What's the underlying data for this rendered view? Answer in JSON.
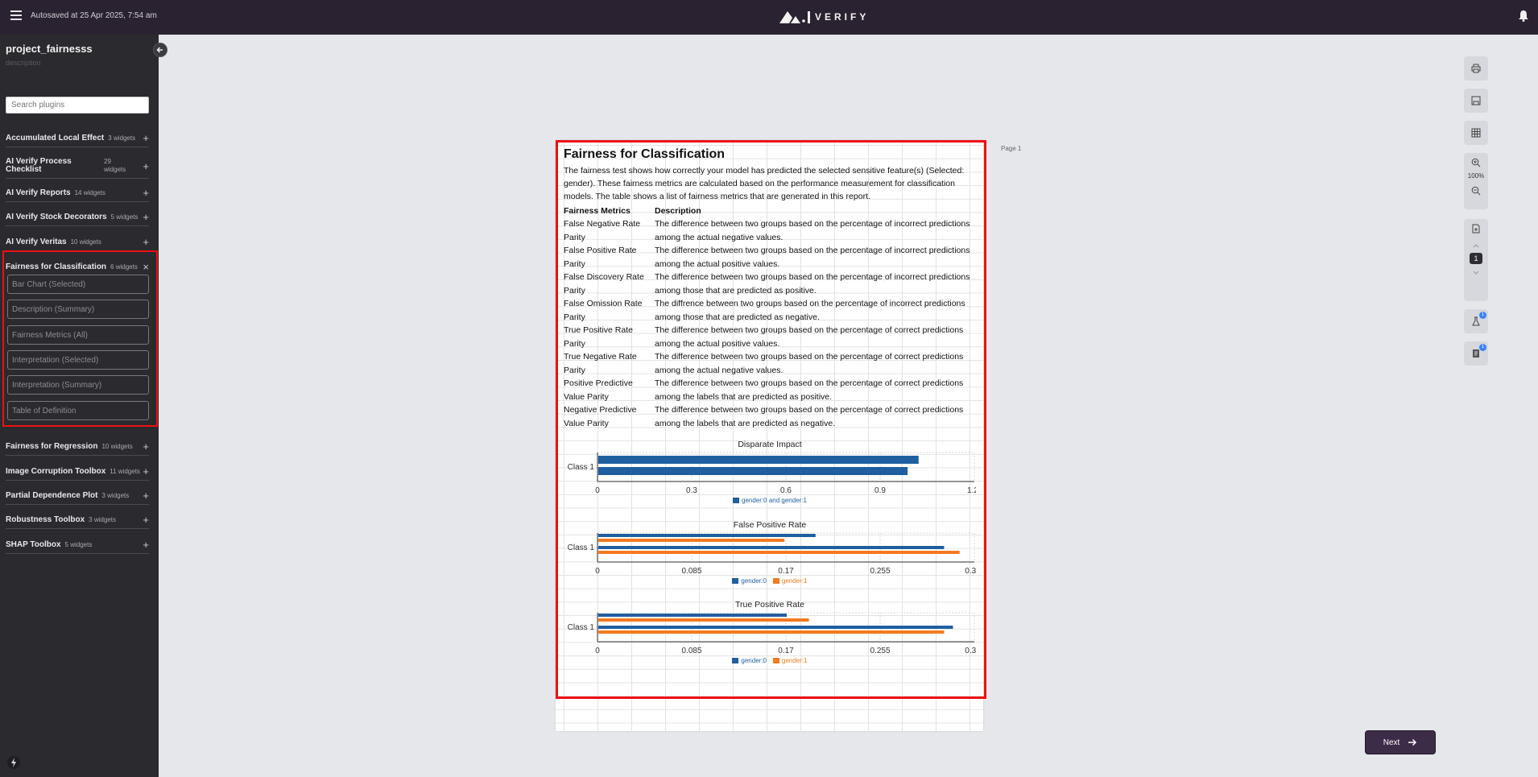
{
  "topbar": {
    "autosave": "Autosaved at 25 Apr 2025, 7:54 am",
    "logo_text": "VERIFY"
  },
  "sidebar": {
    "project_title": "project_fairnesss",
    "project_description": "description",
    "search_placeholder": "Search plugins",
    "plugins": [
      {
        "name": "Accumulated Local Effect",
        "count": "3 widgets",
        "action": "+"
      },
      {
        "name": "AI Verify Process Checklist",
        "count": "29 widgets",
        "action": "+"
      },
      {
        "name": "AI Verify Reports",
        "count": "14 widgets",
        "action": "+"
      },
      {
        "name": "AI Verify Stock Decorators",
        "count": "5 widgets",
        "action": "+"
      },
      {
        "name": "AI Verify Veritas",
        "count": "10 widgets",
        "action": "+"
      },
      {
        "name": "Fairness for Classification",
        "count": "6 widgets",
        "action": "×"
      },
      {
        "name": "Fairness for Regression",
        "count": "10 widgets",
        "action": "+"
      },
      {
        "name": "Image Corruption Toolbox",
        "count": "11 widgets",
        "action": "+"
      },
      {
        "name": "Partial Dependence Plot",
        "count": "3 widgets",
        "action": "+"
      },
      {
        "name": "Robustness Toolbox",
        "count": "3 widgets",
        "action": "+"
      },
      {
        "name": "SHAP Toolbox",
        "count": "5 widgets",
        "action": "+"
      }
    ],
    "widgets": [
      "Bar Chart (Selected)",
      "Description (Summary)",
      "Fairness Metrics (All)",
      "Interpretation (Selected)",
      "Interpretation (Summary)",
      "Table of Definition"
    ]
  },
  "page": {
    "label": "Page 1",
    "title": "Fairness for Classification",
    "intro": "The fairness test shows how correctly your model has predicted the selected sensitive feature(s) (Selected: gender). These fairness metrics are calculated based on the performance measurement for classification models. The table shows a list of fairness metrics that are generated in this report.",
    "table_headers": [
      "Fairness Metrics",
      "Description"
    ],
    "metrics": [
      {
        "name": "False Negative Rate Parity",
        "desc": "The difference between two groups based on the percentage of incorrect predictions among the actual negative values."
      },
      {
        "name": "False Positive Rate Parity",
        "desc": "The difference between two groups based on the percentage of incorrect predictions among the actual positive values."
      },
      {
        "name": "False Discovery Rate Parity",
        "desc": "The difference between two groups based on the percentage of incorrect predictions among those that are predicted as positive."
      },
      {
        "name": "False Omission Rate Parity",
        "desc": "The diffrence between two groups based on the percentage of incorrect predictions among those that are predicted as negative."
      },
      {
        "name": "True Positive Rate Parity",
        "desc": "The difference between two groups based on the percentage of correct predictions among the actual positive values."
      },
      {
        "name": "True Negative Rate Parity",
        "desc": "The difference between two groups based on the percentage of correct predictions among the actual negative values."
      },
      {
        "name": "Positive Predictive Value Parity",
        "desc": "The difference between two groups based on the percentage of correct predictions among the labels that are predicted as positive."
      },
      {
        "name": "Negative Predictive Value Parity",
        "desc": "The difference between two groups based on the percentage of correct predictions among the labels that are predicted as negative."
      }
    ]
  },
  "chart_data": [
    {
      "type": "bar",
      "title": "Disparate Impact",
      "categories": [
        "Class 1"
      ],
      "ticks": [
        "0",
        "0.3",
        "0.6",
        "0.9",
        "1.2"
      ],
      "xlim": [
        0,
        1.2
      ],
      "series": [
        {
          "name": "gender:0 and gender:1",
          "values": [
            1.02,
            0.985
          ],
          "color": "#1f5fa0"
        }
      ],
      "legend": [
        "gender:0 and gender:1"
      ]
    },
    {
      "type": "bar",
      "title": "False Positive Rate",
      "categories": [
        "Class 1"
      ],
      "ticks": [
        "0",
        "0.085",
        "0.17",
        "0.255",
        "0.34"
      ],
      "xlim": [
        0,
        0.34
      ],
      "series": [
        {
          "name": "gender:0",
          "values": [
            0.196,
            0.312
          ],
          "color": "#1f5fa0"
        },
        {
          "name": "gender:1",
          "values": [
            0.168,
            0.326
          ],
          "color": "#f47a1f"
        }
      ],
      "legend": [
        "gender:0",
        "gender:1"
      ]
    },
    {
      "type": "bar",
      "title": "True Positive Rate",
      "categories": [
        "Class 1"
      ],
      "ticks": [
        "0",
        "0.085",
        "0.17",
        "0.255",
        "0.34"
      ],
      "xlim": [
        0,
        0.34
      ],
      "series": [
        {
          "name": "gender:0",
          "values": [
            0.17,
            0.32
          ],
          "color": "#1f5fa0"
        },
        {
          "name": "gender:1",
          "values": [
            0.19,
            0.312
          ],
          "color": "#f47a1f"
        }
      ],
      "legend": [
        "gender:0",
        "gender:1"
      ]
    }
  ],
  "toolbar": {
    "zoom": "100%",
    "page_number": "1",
    "badge_1": "1",
    "badge_2": "1"
  },
  "footer": {
    "next_label": "Next"
  },
  "colors": {
    "topbar": "#2b2231",
    "sidebar": "#2b2a2f",
    "highlight": "#e11111",
    "series_blue": "#1f5fa0",
    "series_orange": "#f47a1f"
  }
}
